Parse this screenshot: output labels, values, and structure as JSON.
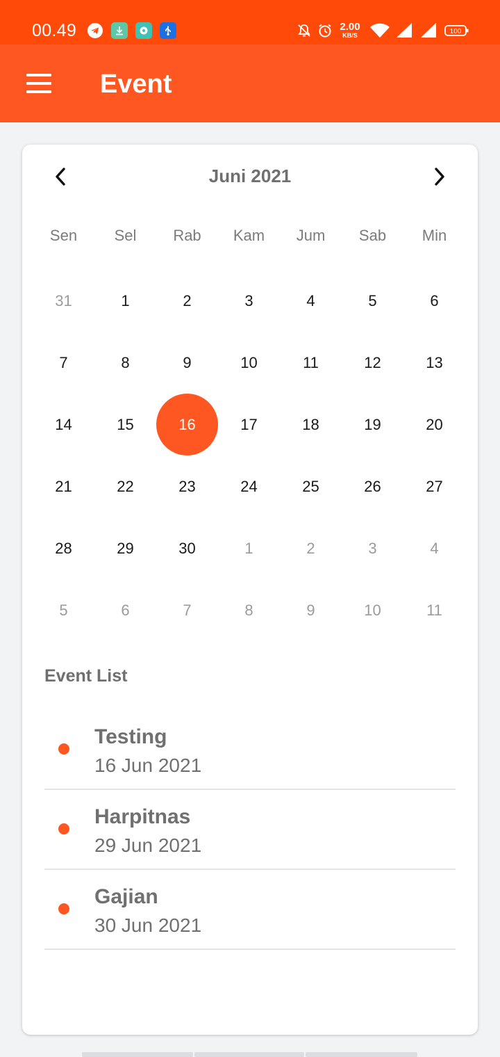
{
  "status_bar": {
    "time": "00.49",
    "net_speed": "2.00",
    "net_unit": "KB/S",
    "battery": "100",
    "icons": [
      "telegram-icon",
      "download-icon",
      "chat-icon",
      "usb-icon",
      "mute-icon",
      "alarm-icon",
      "wifi-icon",
      "signal-icon",
      "signal-icon",
      "battery-icon"
    ]
  },
  "app_bar": {
    "title": "Event",
    "menu_icon": "hamburger-menu-icon",
    "color": "#ff5722"
  },
  "calendar": {
    "month_label": "Juni 2021",
    "prev_icon": "chevron-left-icon",
    "next_icon": "chevron-right-icon",
    "weekdays": [
      "Sen",
      "Sel",
      "Rab",
      "Kam",
      "Jum",
      "Sab",
      "Min"
    ],
    "days": [
      {
        "n": "31",
        "m": true
      },
      {
        "n": "1"
      },
      {
        "n": "2"
      },
      {
        "n": "3"
      },
      {
        "n": "4"
      },
      {
        "n": "5"
      },
      {
        "n": "6"
      },
      {
        "n": "7"
      },
      {
        "n": "8"
      },
      {
        "n": "9"
      },
      {
        "n": "10"
      },
      {
        "n": "11"
      },
      {
        "n": "12"
      },
      {
        "n": "13"
      },
      {
        "n": "14"
      },
      {
        "n": "15"
      },
      {
        "n": "16",
        "s": true
      },
      {
        "n": "17"
      },
      {
        "n": "18"
      },
      {
        "n": "19"
      },
      {
        "n": "20"
      },
      {
        "n": "21"
      },
      {
        "n": "22"
      },
      {
        "n": "23"
      },
      {
        "n": "24"
      },
      {
        "n": "25"
      },
      {
        "n": "26"
      },
      {
        "n": "27"
      },
      {
        "n": "28"
      },
      {
        "n": "29"
      },
      {
        "n": "30"
      },
      {
        "n": "1",
        "m": true
      },
      {
        "n": "2",
        "m": true
      },
      {
        "n": "3",
        "m": true
      },
      {
        "n": "4",
        "m": true
      },
      {
        "n": "5",
        "m": true
      },
      {
        "n": "6",
        "m": true
      },
      {
        "n": "7",
        "m": true
      },
      {
        "n": "8",
        "m": true
      },
      {
        "n": "9",
        "m": true
      },
      {
        "n": "10",
        "m": true
      },
      {
        "n": "11",
        "m": true
      }
    ],
    "selected_color": "#ff5722"
  },
  "event_list": {
    "title": "Event List",
    "events": [
      {
        "name": "Testing",
        "date": "16 Jun 2021"
      },
      {
        "name": "Harpitnas",
        "date": "29 Jun 2021"
      },
      {
        "name": "Gajian",
        "date": "30 Jun 2021"
      }
    ]
  }
}
